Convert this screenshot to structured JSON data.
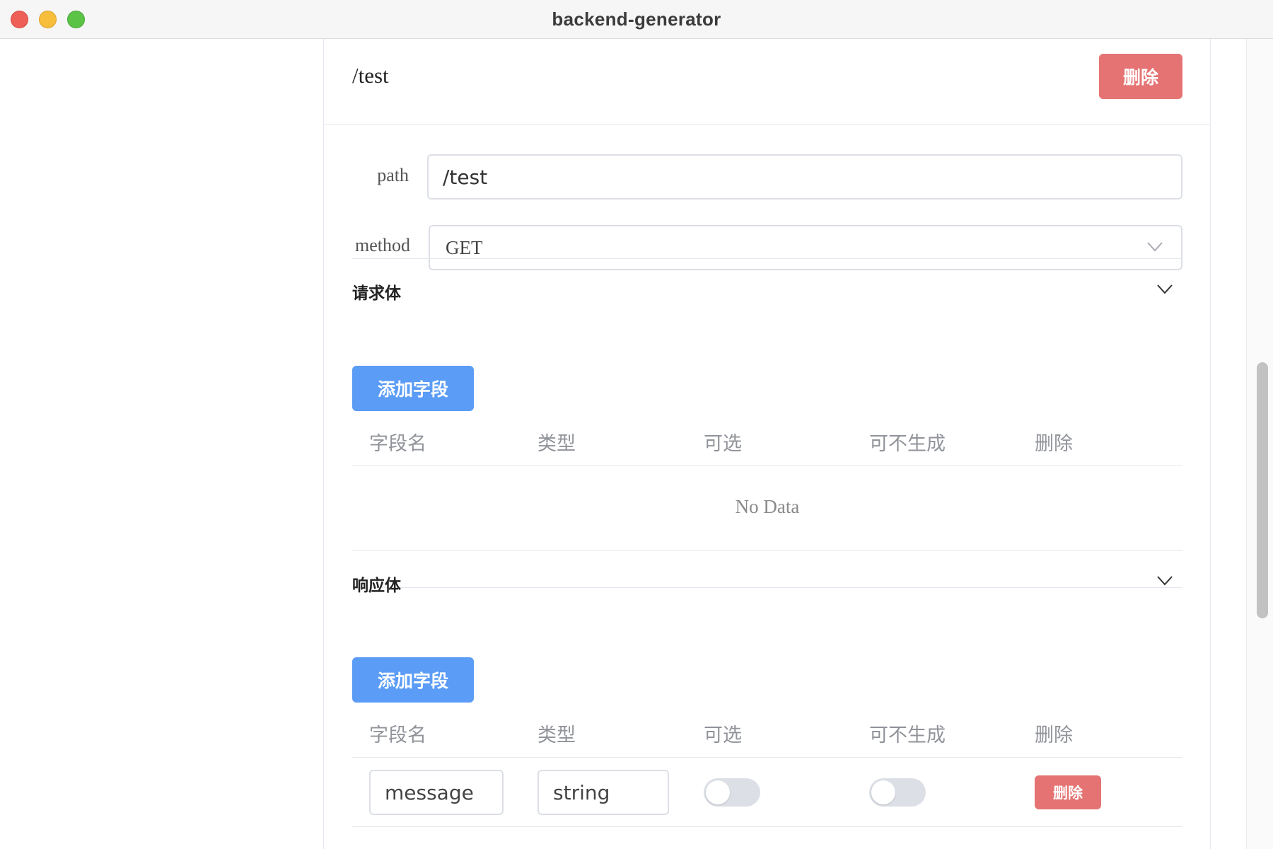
{
  "window": {
    "title": "backend-generator"
  },
  "route": {
    "title": "/test",
    "delete_label": "删除"
  },
  "form": {
    "path_label": "path",
    "path_value": "/test",
    "method_label": "method",
    "method_value": "GET"
  },
  "request_body": {
    "title": "请求体",
    "add_label": "添加字段",
    "columns": [
      "字段名",
      "类型",
      "可选",
      "可不生成",
      "删除"
    ],
    "empty_text": "No Data",
    "rows": []
  },
  "response_body": {
    "title": "响应体",
    "add_label": "添加字段",
    "columns": [
      "字段名",
      "类型",
      "可选",
      "可不生成",
      "删除"
    ],
    "rows": [
      {
        "name": "message",
        "type": "string",
        "optional": false,
        "skip_generate": false,
        "delete_label": "删除"
      }
    ]
  },
  "colors": {
    "danger": "#e57373",
    "primary": "#5b9cf6",
    "switch_off": "#dcdfe6"
  },
  "icons": {
    "select_arrow": "chevron-down-icon",
    "collapse_arrow": "chevron-down-icon"
  }
}
